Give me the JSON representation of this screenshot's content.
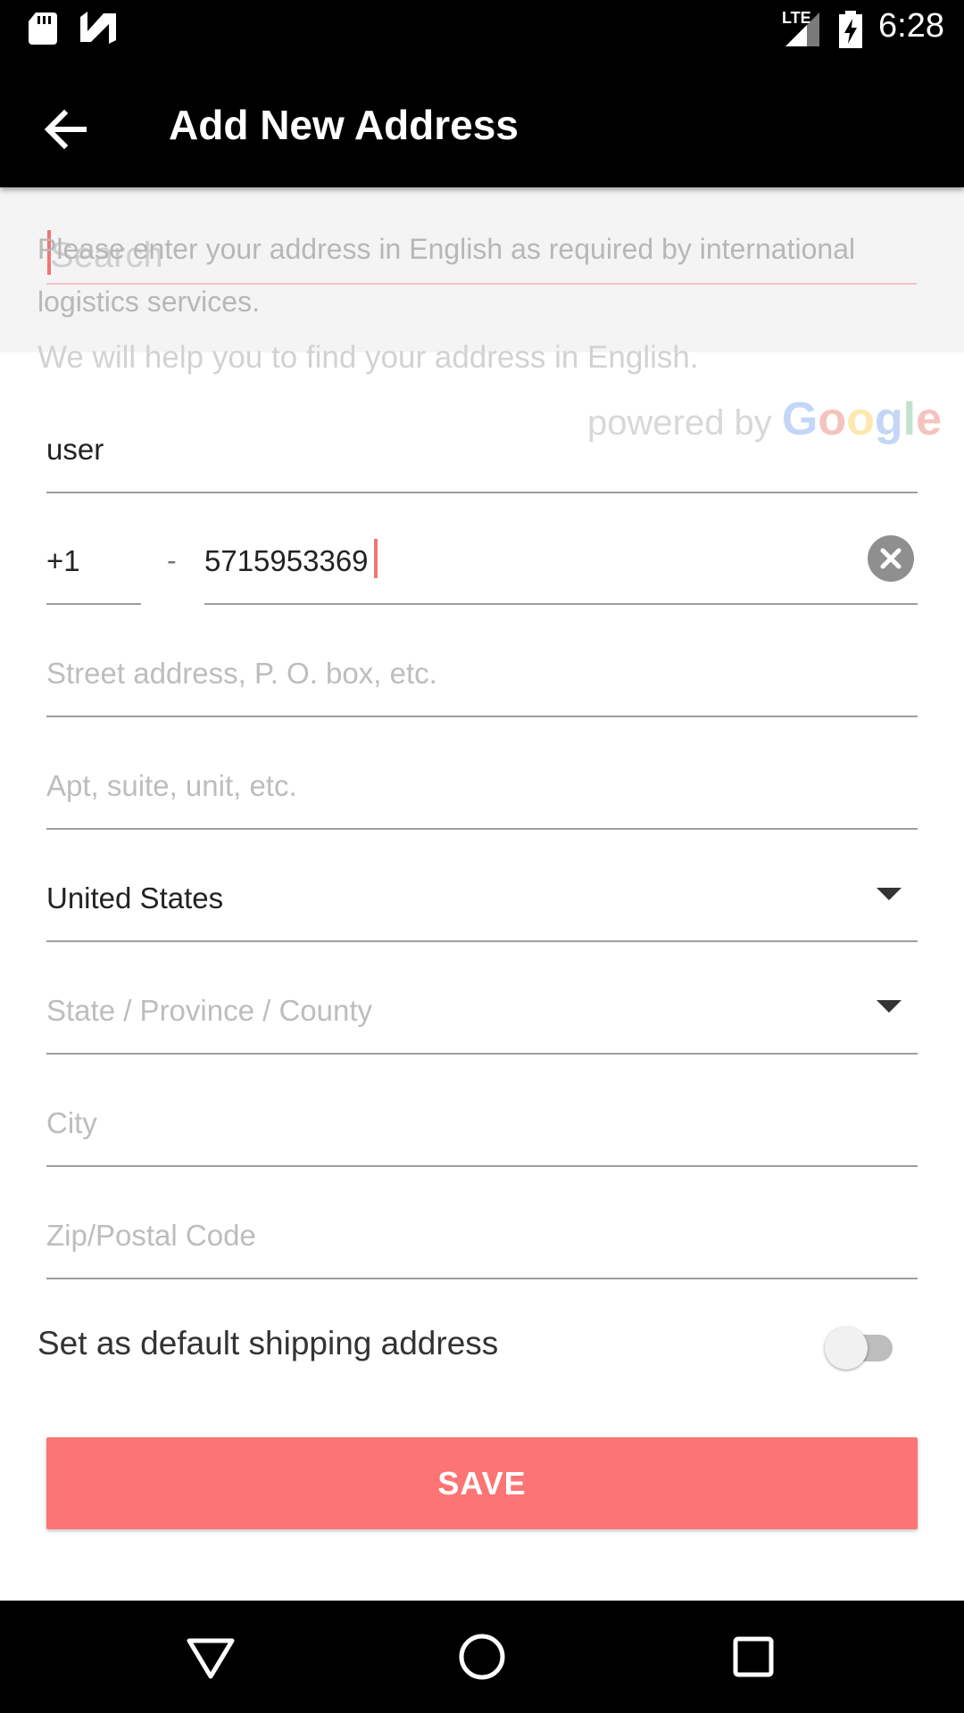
{
  "status_bar": {
    "time": "6:28",
    "network": "LTE",
    "icons": [
      "sd-card-icon",
      "n-icon",
      "signal-icon",
      "battery-charging-icon"
    ]
  },
  "app_bar": {
    "title": "Add New Address",
    "back_icon": "arrow-back-icon"
  },
  "search": {
    "placeholder": "Search",
    "info_line1": "Please enter your address in English as required by international",
    "info_line2": "logistics services.",
    "help": "We will help you to find your address in English.",
    "powered_prefix": "powered by ",
    "powered_brand": "Google"
  },
  "form": {
    "name_value": "user",
    "country_code": "+1",
    "separator": "-",
    "phone_value": "5715953369",
    "street_placeholder": "Street address, P. O. box, etc.",
    "apt_placeholder": "Apt, suite, unit, etc.",
    "country_value": "United States",
    "state_placeholder": "State / Province / County",
    "city_placeholder": "City",
    "zip_placeholder": "Zip/Postal Code"
  },
  "default_shipping": {
    "label": "Set as default shipping address",
    "enabled": false
  },
  "save_label": "SAVE",
  "colors": {
    "accent": "#fc7474",
    "bar": "#000000",
    "google_blue": "#4285F4",
    "google_red": "#EA4335",
    "google_yellow": "#FBBC05",
    "google_green": "#34A853"
  },
  "nav_bar": {
    "icons": [
      "back-triangle-icon",
      "home-circle-icon",
      "recents-square-icon"
    ]
  }
}
